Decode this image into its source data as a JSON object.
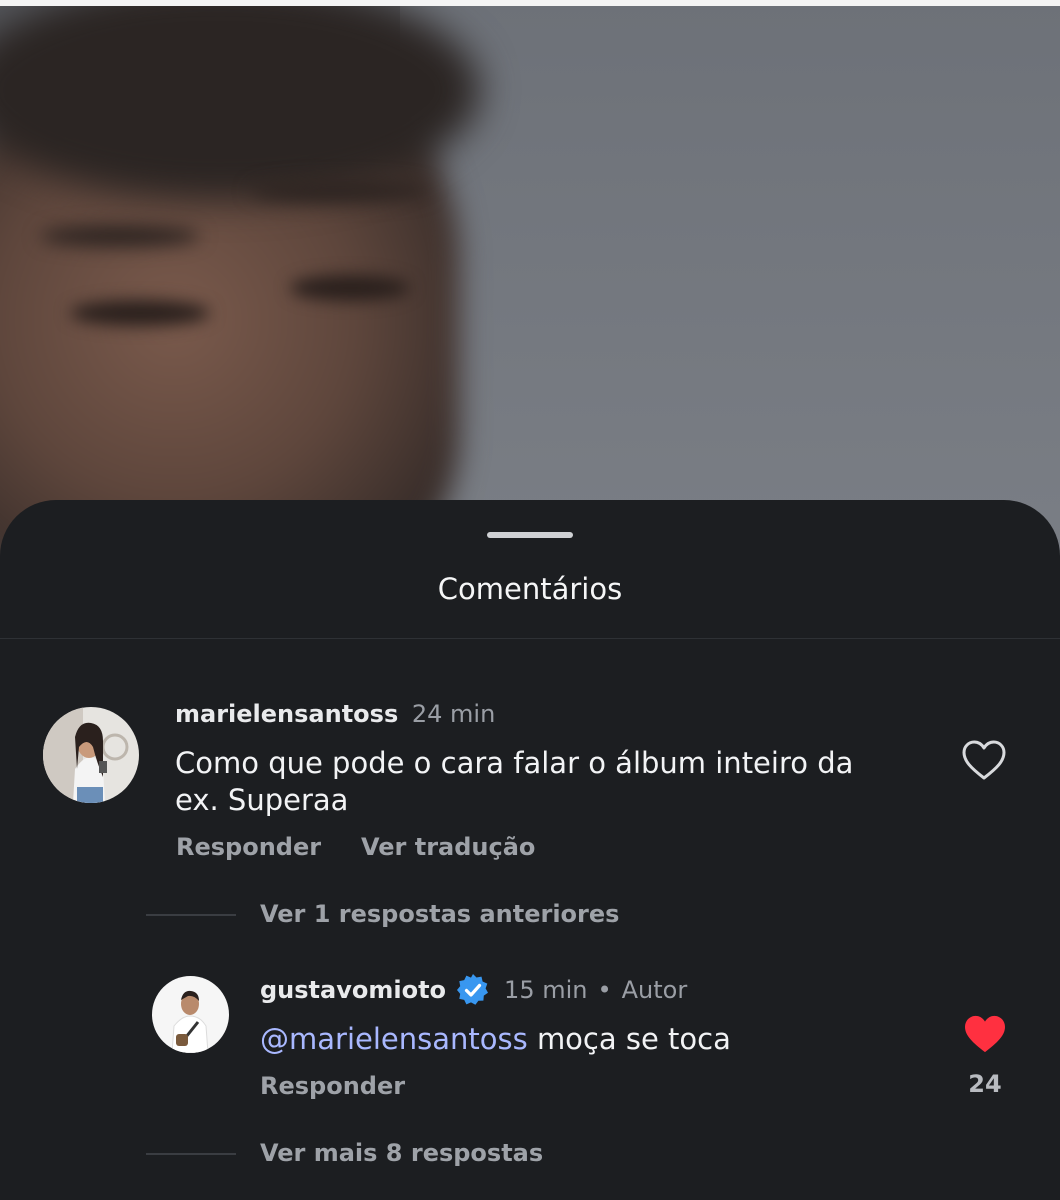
{
  "sheet": {
    "title": "Comentários"
  },
  "comments": [
    {
      "username": "marielensantoss",
      "time": "24 min",
      "text_line1": "Como que pode o cara falar o álbum inteiro da",
      "text_line2": "ex. Superaa",
      "reply_label": "Responder",
      "translate_label": "Ver tradução",
      "liked": false
    }
  ],
  "thread": {
    "view_previous_label": "Ver 1 respostas anteriores",
    "view_more_label": "Ver mais 8 respostas"
  },
  "reply": {
    "username": "gustavomioto",
    "verified": true,
    "time": "15 min",
    "separator": "•",
    "author_label": "Autor",
    "mention": "@marielensantoss",
    "text": "moça se toca",
    "reply_label": "Responder",
    "likes": "24",
    "liked": true
  },
  "colors": {
    "mention": "#a9b8ff",
    "like": "#ff3040",
    "verified": "#3897f0",
    "sheet": "#1c1e21"
  }
}
